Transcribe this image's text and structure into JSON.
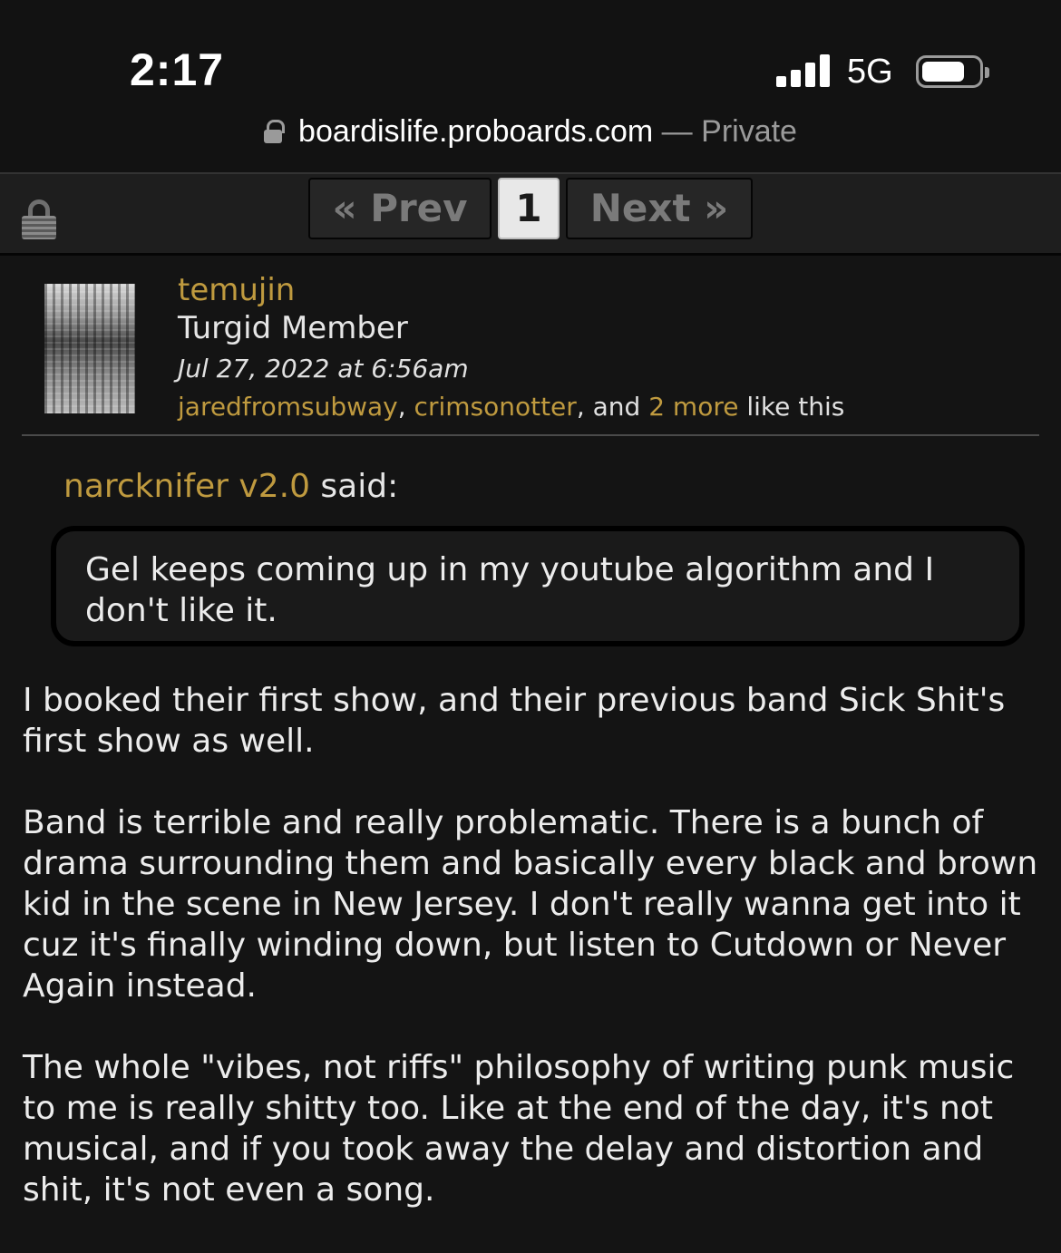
{
  "status_bar": {
    "time": "2:17",
    "network": "5G"
  },
  "url_bar": {
    "domain": "boardislife.proboards.com",
    "separator": " — ",
    "mode": "Private"
  },
  "pagination": {
    "prev_label": "« Prev",
    "current_page": "1",
    "next_label": "Next »"
  },
  "post": {
    "username": "temujin",
    "rank": "Turgid Member",
    "date": "Jul 27, 2022 at 6:56am",
    "likes": {
      "user1": "jaredfromsubway",
      "sep1": ", ",
      "user2": "crimsonotter",
      "sep2": ", and ",
      "more": "2 more",
      "suffix": " like this"
    },
    "quote": {
      "author": "narcknifer v2.0",
      "said_label": " said:",
      "text": "Gel keeps coming up in my youtube algorithm and I don't like it."
    },
    "paragraphs": [
      "I booked their first show, and their previous band Sick Shit's first show as well.",
      "Band is terrible and really problematic. There is a bunch of drama surrounding them and basically every black and brown kid in the scene in New Jersey. I don't really wanna get into it cuz it's finally winding down, but listen to Cutdown or Never Again instead.",
      "The whole \"vibes, not riffs\" philosophy of writing punk music to me is really shitty too. Like at the end of the day, it's not musical, and if you took away the delay and distortion and shit, it's not even a song."
    ]
  },
  "colors": {
    "accent": "#bf9a3f",
    "background": "#141414",
    "text": "#ececec"
  },
  "icons": [
    "lock-icon",
    "signal-icon",
    "battery-icon",
    "padlock-icon"
  ]
}
